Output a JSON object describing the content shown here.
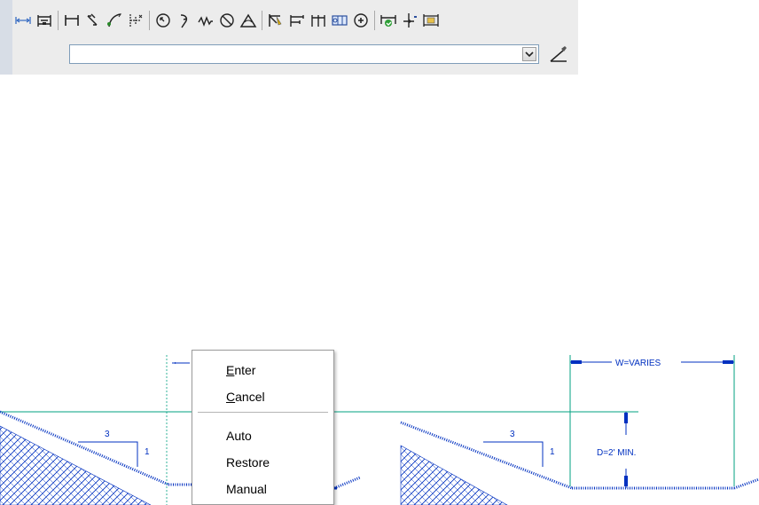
{
  "toolbar": {
    "row1_icons": [
      "linear-dimension-icon",
      "aligned-dimension-icon",
      "arc-length-icon",
      "ordinate-dimension-icon",
      "radius-dimension-icon",
      "jogged-dimension-icon",
      "diameter-dimension-icon",
      "angular-dimension-icon",
      "quick-dimension-icon",
      "baseline-dimension-icon",
      "continue-dimension-icon",
      "tolerance-icon",
      "center-mark-icon",
      "inspection-icon",
      "jogged-linear-icon",
      "dimension-edit-icon",
      "dimension-text-edit-icon",
      "dimension-update-icon"
    ],
    "dimension_style_value": ""
  },
  "drawing": {
    "left_slope_run": "3",
    "left_slope_rise": "1",
    "right_slope_run": "3",
    "right_slope_rise": "1",
    "width_label": "W=VARIES",
    "depth_label": "D=2' MIN."
  },
  "context_menu": {
    "enter": {
      "first": "E",
      "rest": "nter"
    },
    "cancel": {
      "first": "C",
      "rest": "ancel"
    },
    "auto": "Auto",
    "restore": "Restore",
    "manual": "Manual"
  },
  "colors": {
    "cad_blue": "#0030c0",
    "cad_green": "#00a080",
    "toolbar_bg": "#ececec"
  }
}
